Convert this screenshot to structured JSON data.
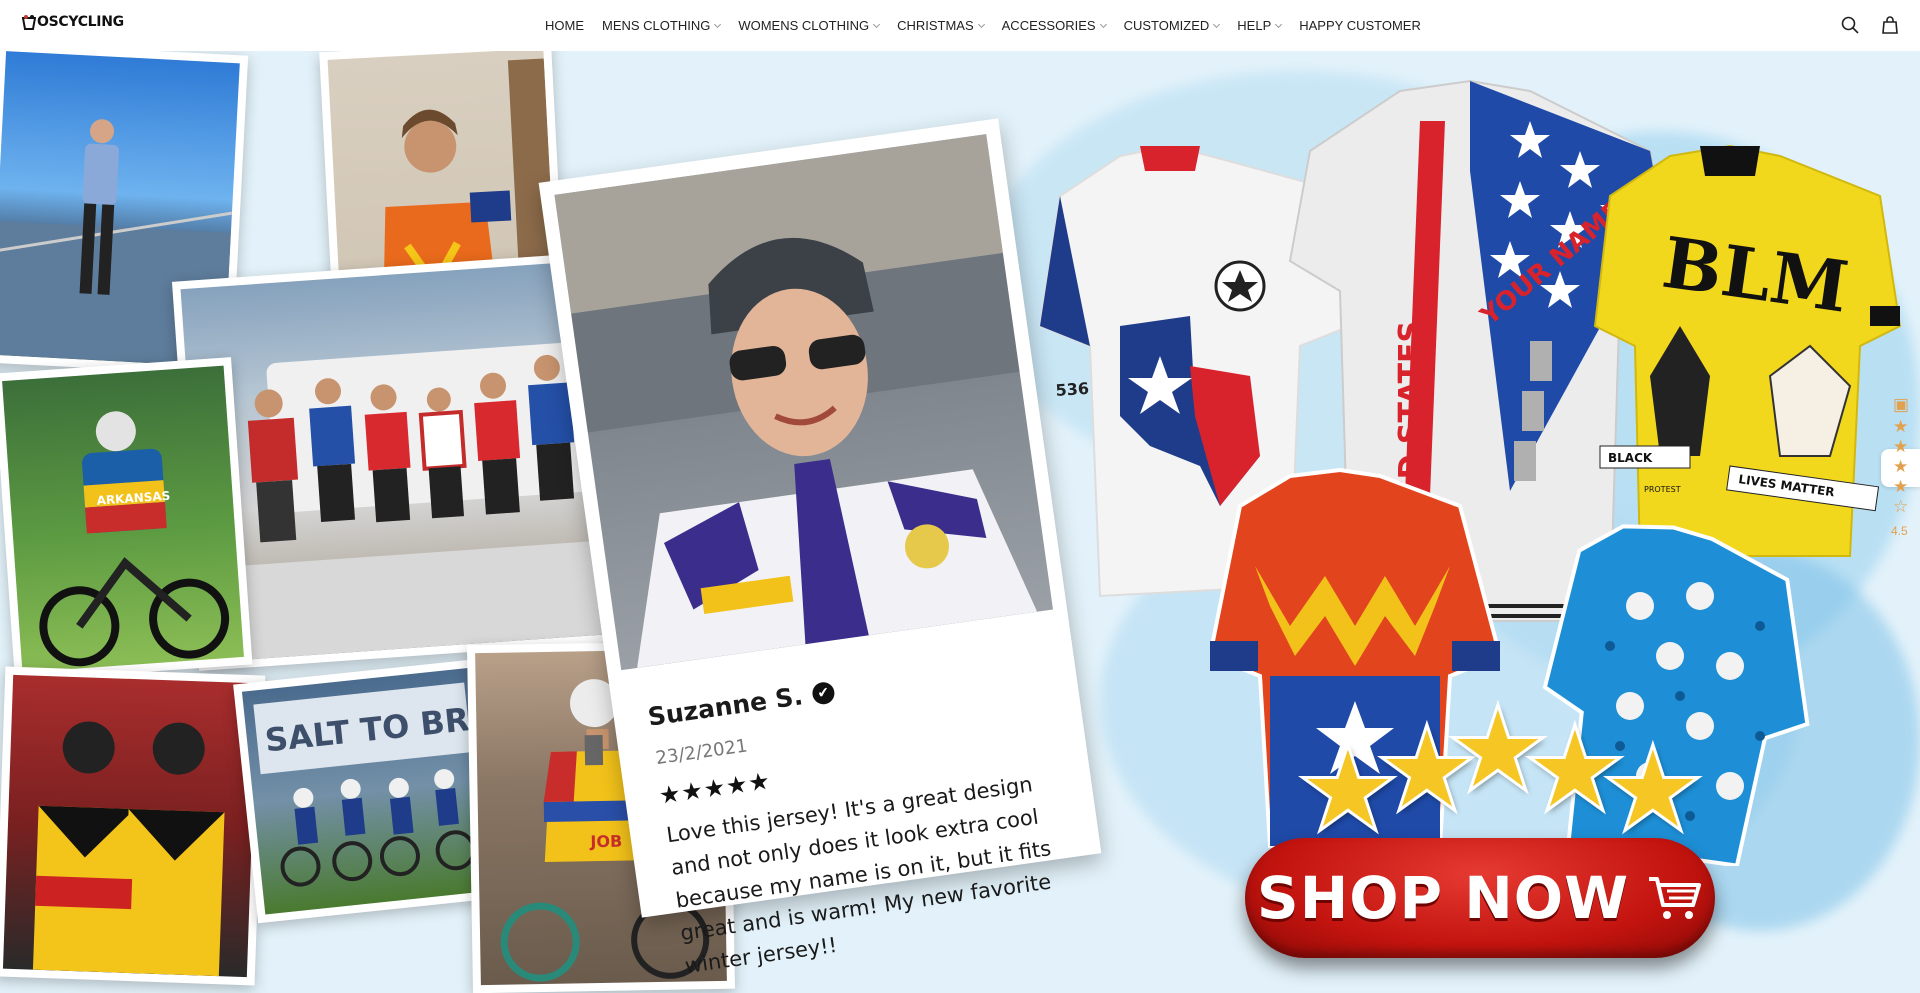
{
  "brand": {
    "name": "OSCYCLING"
  },
  "nav": {
    "items": [
      {
        "label": "HOME",
        "has_dropdown": false
      },
      {
        "label": "MENS CLOTHING",
        "has_dropdown": true
      },
      {
        "label": "WOMENS CLOTHING",
        "has_dropdown": true
      },
      {
        "label": "CHRISTMAS",
        "has_dropdown": true
      },
      {
        "label": "ACCESSORIES",
        "has_dropdown": true
      },
      {
        "label": "CUSTOMIZED",
        "has_dropdown": true
      },
      {
        "label": "HELP",
        "has_dropdown": true
      },
      {
        "label": "HAPPY CUSTOMER",
        "has_dropdown": false
      }
    ]
  },
  "header_icons": {
    "search": "search-icon",
    "cart": "shopping-bag-icon"
  },
  "review": {
    "name": "Suzanne S.",
    "date": "23/2/2021",
    "stars": "★★★★★",
    "text": "Love this jersey!  It's a great design and not only does it look extra cool because my name is on it, but it fits great and is warm! My new favorite winter jersey!!"
  },
  "jerseys": {
    "usa": {
      "text_name": "YOUR NAME",
      "text_country": "UNITED STATES"
    },
    "blm": {
      "text_top": "BLM",
      "text_left": "BLACK",
      "text_right": "LIVES MATTER",
      "text_small": "PROTEST"
    },
    "texas": {
      "text_number": "536"
    }
  },
  "photos": {
    "rider_shirt": "ARKANSAS",
    "banner_text": "SALT TO BRIN",
    "jersey_word": "JOB"
  },
  "cta": {
    "label": "SHOP NOW"
  },
  "rating_widget": {
    "value": "4.5"
  },
  "colors": {
    "hero_bg": "#e3f2fa",
    "cta_red": "#c4140f",
    "star_gold": "#f6c624",
    "rating_orange": "#e2a14e"
  }
}
